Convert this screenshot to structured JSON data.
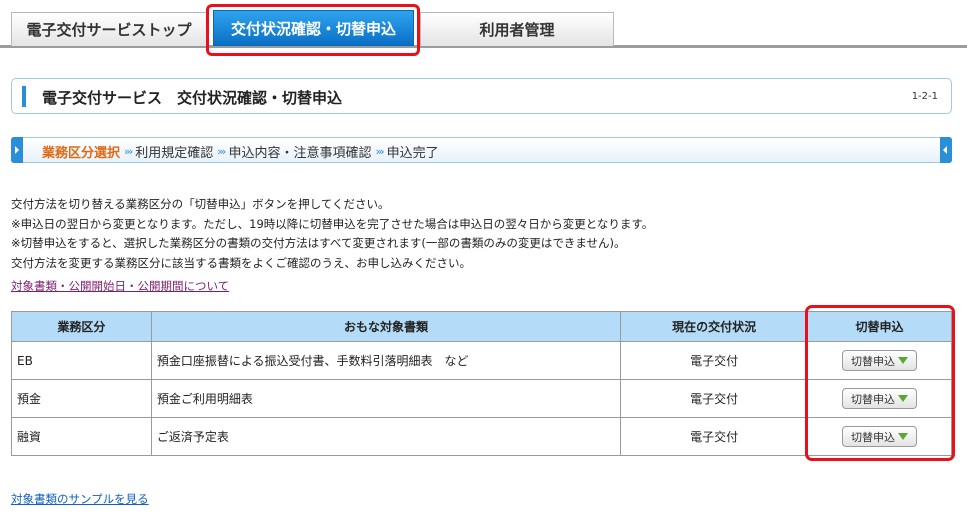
{
  "tabs": {
    "top": "電子交付サービストップ",
    "status": "交付状況確認・切替申込",
    "user": "利用者管理"
  },
  "header": {
    "title": "電子交付サービス　交付状況確認・切替申込",
    "code": "1-2-1"
  },
  "steps": [
    "業務区分選択",
    "利用規定確認",
    "申込内容・注意事項確認",
    "申込完了"
  ],
  "intro": [
    "交付方法を切り替える業務区分の「切替申込」ボタンを押してください。",
    "※申込日の翌日から変更となります。ただし、19時以降に切替申込を完了させた場合は申込日の翌々日から変更となります。",
    "※切替申込をすると、選択した業務区分の書類の交付方法はすべて変更されます(一部の書類のみの変更はできません)。",
    "交付方法を変更する業務区分に該当する書類をよくご確認のうえ、お申し込みください。"
  ],
  "links": {
    "about": "対象書類・公開開始日・公開期間について",
    "sample": "対象書類のサンプルを見る"
  },
  "table": {
    "headers": [
      "業務区分",
      "おもな対象書類",
      "現在の交付状況",
      "切替申込"
    ],
    "rows": [
      {
        "category": "EB",
        "docs": "預金口座振替による振込受付書、手数料引落明細表　など",
        "status": "電子交付",
        "button": "切替申込"
      },
      {
        "category": "預金",
        "docs": "預金ご利用明細表",
        "status": "電子交付",
        "button": "切替申込"
      },
      {
        "category": "融資",
        "docs": "ご返済予定表",
        "status": "電子交付",
        "button": "切替申込"
      }
    ]
  },
  "colors": {
    "accent": "#2a8fd6",
    "active_step": "#e06a13",
    "highlight": "#e8101a",
    "table_header": "#b4dcf8"
  }
}
